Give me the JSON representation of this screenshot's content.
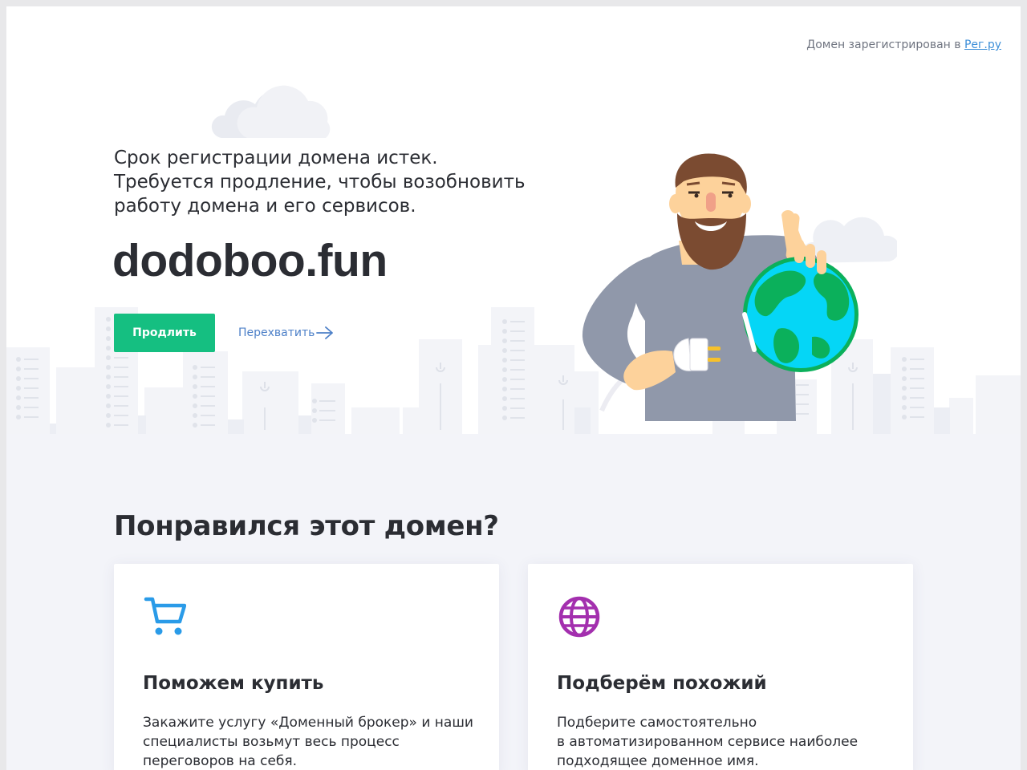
{
  "registrar": {
    "text": "Домен зарегистрирован в ",
    "link_label": "Рег.ру"
  },
  "hero": {
    "expired_lines": [
      "Срок регистрации домена истек.",
      "Требуется продление, чтобы возобновить",
      "работу домена и его сервисов."
    ],
    "domain": "dodoboo.fun",
    "renew_label": "Продлить",
    "intercept_label": "Перехватить"
  },
  "offers": {
    "title": "Понравился этот домен?",
    "cards": [
      {
        "icon": "cart-icon",
        "title": "Поможем купить",
        "text_lines": [
          "Закажите услугу «Доменный брокер» и наши",
          "специалисты возьмут весь процесс",
          "переговоров на себя."
        ]
      },
      {
        "icon": "globe-icon",
        "title": "Подберём похожий",
        "text_lines": [
          "Подберите самостоятельно",
          "в автоматизированном сервисе наиболее",
          "подходящее доменное имя."
        ]
      }
    ]
  },
  "colors": {
    "accent_green": "#15bf81",
    "link_blue": "#4d80c8",
    "cart_blue": "#2a9be8",
    "globe_purple": "#a32fae",
    "lower_bg": "#f3f4f9"
  }
}
